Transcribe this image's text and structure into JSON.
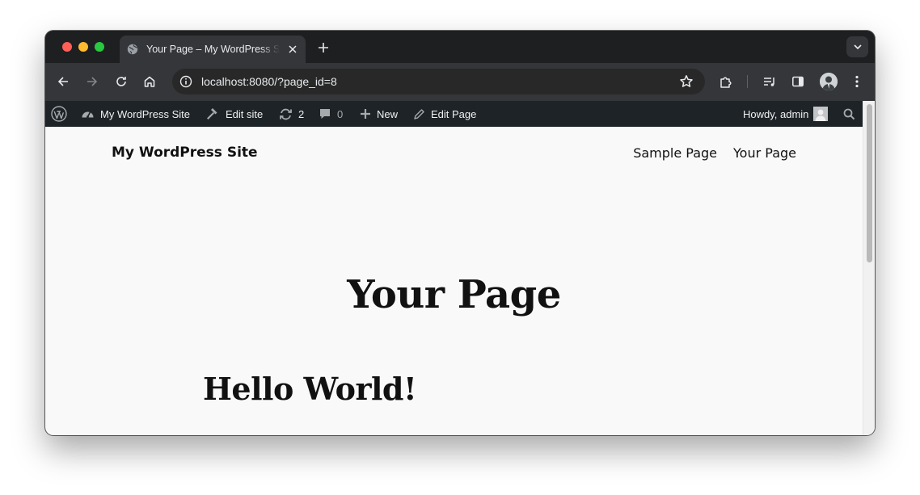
{
  "browser": {
    "tab": {
      "title": "Your Page – My WordPress Site"
    },
    "address_bar": {
      "url": "localhost:8080/?page_id=8"
    }
  },
  "admin_bar": {
    "site_name": "My WordPress Site",
    "edit_site": "Edit site",
    "updates_count": "2",
    "comments_count": "0",
    "new_label": "New",
    "edit_page": "Edit Page",
    "howdy": "Howdy, admin"
  },
  "site": {
    "title": "My WordPress Site",
    "nav": [
      "Sample Page",
      "Your Page"
    ]
  },
  "page": {
    "title": "Your Page",
    "heading": "Hello World!"
  }
}
